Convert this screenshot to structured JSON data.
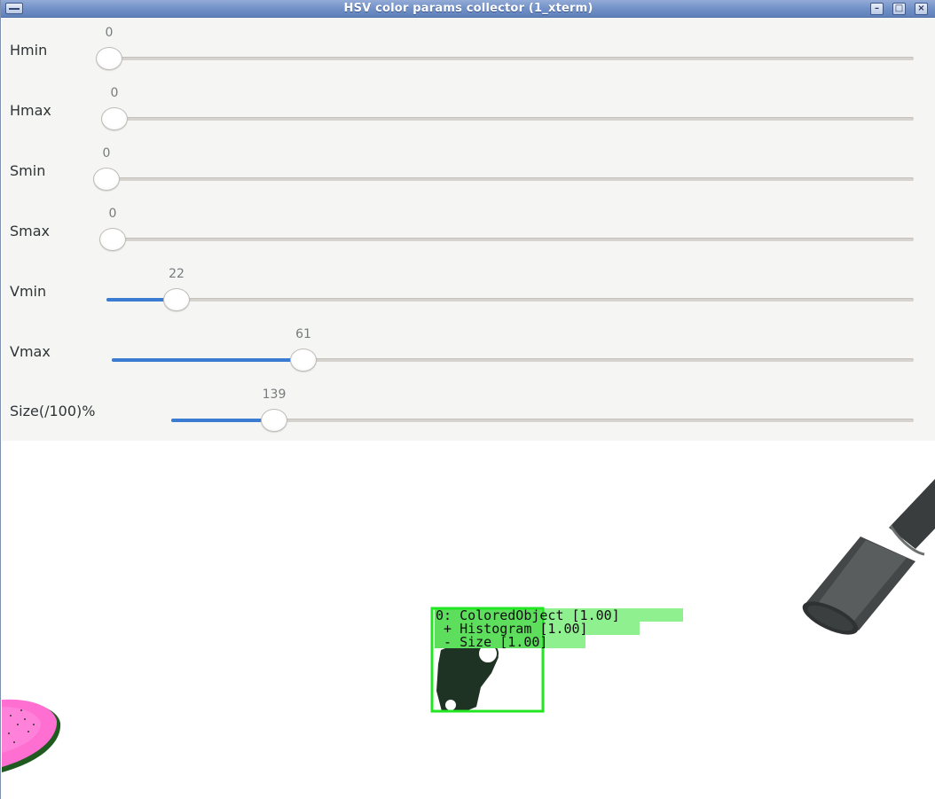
{
  "window": {
    "title": "HSV color params collector (1_xterm)",
    "buttons": {
      "minimize": "–",
      "maximize": "□",
      "close": "×"
    }
  },
  "sliders": [
    {
      "label": "Hmin",
      "value": "0"
    },
    {
      "label": "Hmax",
      "value": "0"
    },
    {
      "label": "Smin",
      "value": "0"
    },
    {
      "label": "Smax",
      "value": "0"
    },
    {
      "label": "Vmin",
      "value": "22"
    },
    {
      "label": "Vmax",
      "value": "61"
    },
    {
      "label": "Size(/100)%",
      "value": "139"
    }
  ],
  "detection": {
    "line1": "0: ColoredObject [1.00]",
    "line2": " + Histogram [1.00]",
    "line3": " - Size [1.00]",
    "box_color": "#22e622",
    "label_bg": "#8ef08e"
  },
  "colors": {
    "accent": "#3a7cd2",
    "title_bar": "#6f8fc6"
  }
}
